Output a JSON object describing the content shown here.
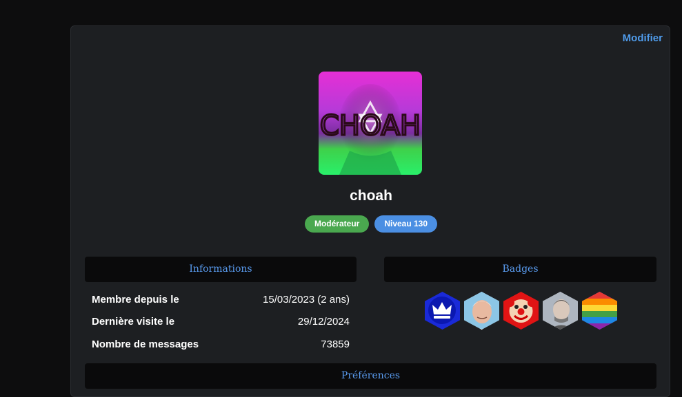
{
  "profile": {
    "edit_label": "Modifier",
    "avatar_text": "CHOAH",
    "username": "choah",
    "roles": [
      {
        "label": "Modérateur",
        "color": "#4aa84f"
      },
      {
        "label": "Niveau 130",
        "color": "#4b8fe3"
      }
    ]
  },
  "info": {
    "title": "Informations",
    "rows": [
      {
        "label": "Membre depuis le",
        "value": "15/03/2023 (2 ans)"
      },
      {
        "label": "Dernière visite le",
        "value": "29/12/2024"
      },
      {
        "label": "Nombre de messages",
        "value": "73859"
      }
    ]
  },
  "badges": {
    "title": "Badges",
    "items": [
      "crown-badge-icon",
      "harold-face-badge-icon",
      "clown-badge-icon",
      "man-portrait-badge-icon",
      "rainbow-badge-icon"
    ]
  },
  "next_section": {
    "title": "Préférences"
  },
  "colors": {
    "accent": "#4f9bea",
    "panel_header_text": "#5a9cf0",
    "card_bg": "#1d1f22"
  }
}
